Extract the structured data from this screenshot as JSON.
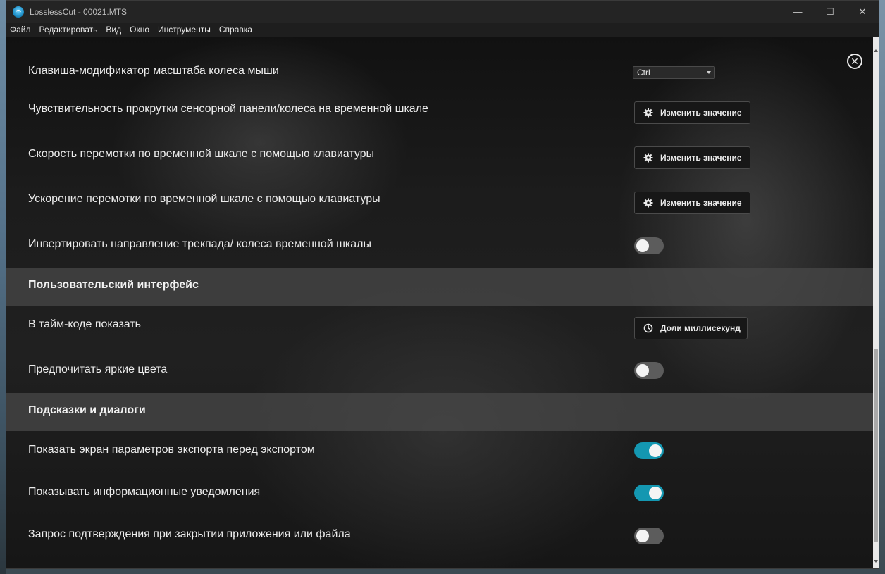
{
  "window": {
    "title": "LosslessCut - 00021.MTS",
    "minimize_glyph": "—",
    "maximize_glyph": "☐",
    "close_glyph": "✕"
  },
  "menu": [
    "Файл",
    "Редактировать",
    "Вид",
    "Окно",
    "Инструменты",
    "Справка"
  ],
  "settings": {
    "close_icon": "close-icon",
    "rows": {
      "wheel_zoom_modifier": {
        "label": "Клавиша-модификатор масштаба колеса мыши",
        "value": "Ctrl"
      },
      "wheel_sensitivity": {
        "label": "Чувствительность прокрутки сенсорной панели/колеса на временной шкале",
        "button": "Изменить значение"
      },
      "keyboard_seek_speed": {
        "label": "Скорость перемотки по временной шкале с помощью клавиатуры",
        "button": "Изменить значение"
      },
      "keyboard_seek_accel": {
        "label": "Ускорение перемотки по временной шкале с помощью клавиатуры",
        "button": "Изменить значение"
      },
      "invert_wheel": {
        "label": "Инвертировать направление трекпада/ колеса временной шкалы",
        "on": false
      }
    },
    "section_ui": "Пользовательский интерфейс",
    "ui_rows": {
      "timecode_show": {
        "label": "В тайм-коде показать",
        "button": "Доли миллисекунд"
      },
      "bright_colors": {
        "label": "Предпочитать яркие цвета",
        "on": false
      }
    },
    "section_hints": "Подсказки и диалоги",
    "hint_rows": {
      "export_confirm": {
        "label": "Показать экран параметров экспорта перед экспортом",
        "on": true
      },
      "info_notifications": {
        "label": "Показывать информационные уведомления",
        "on": true
      },
      "confirm_close": {
        "label": "Запрос подтверждения при закрытии приложения или файла",
        "on": false
      }
    }
  },
  "colors": {
    "toggle_on": "#1497b1",
    "toggle_off": "#5c5c5c",
    "background": "#1b1b1b"
  }
}
